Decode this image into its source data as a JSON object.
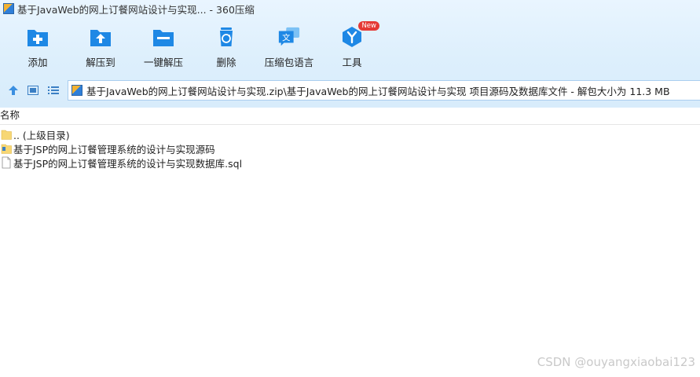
{
  "window": {
    "title": "基于JavaWeb的网上订餐网站设计与实现... - 360压缩"
  },
  "toolbar": {
    "items": [
      {
        "label": "添加",
        "icon": "add-icon"
      },
      {
        "label": "解压到",
        "icon": "extract-to-icon"
      },
      {
        "label": "一键解压",
        "icon": "one-click-extract-icon"
      },
      {
        "label": "删除",
        "icon": "delete-icon"
      },
      {
        "label": "压缩包语言",
        "icon": "archive-language-icon"
      },
      {
        "label": "工具",
        "icon": "tools-icon",
        "badge": "New"
      }
    ]
  },
  "nav": {
    "path": "基于JavaWeb的网上订餐网站设计与实现.zip\\基于JavaWeb的网上订餐网站设计与实现 项目源码及数据库文件 - 解包大小为 11.3 MB"
  },
  "list": {
    "header": "名称",
    "rows": [
      {
        "name": ".. (上级目录)",
        "type": "folder"
      },
      {
        "name": "基于JSP的网上订餐管理系统的设计与实现源码",
        "type": "folder"
      },
      {
        "name": "基于JSP的网上订餐管理系统的设计与实现数据库.sql",
        "type": "file"
      }
    ]
  },
  "watermark": "CSDN @ouyangxiaobai123",
  "colors": {
    "toolbar_bg": "#ddeffc",
    "icon_blue": "#1e88e5",
    "badge_red": "#e53935"
  }
}
